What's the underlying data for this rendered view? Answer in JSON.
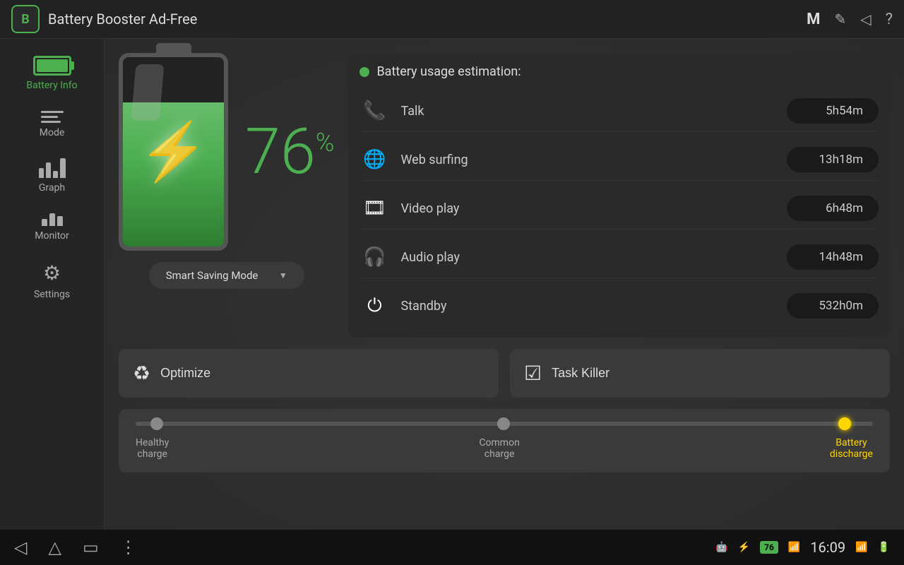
{
  "app": {
    "title": "Battery Booster Ad-Free",
    "icon_label": "B"
  },
  "top_icons": [
    "M",
    "✎",
    "◁",
    "?"
  ],
  "sidebar": {
    "items": [
      {
        "id": "battery-info",
        "label": "Battery Info",
        "active": true
      },
      {
        "id": "mode",
        "label": "Mode",
        "active": false
      },
      {
        "id": "graph",
        "label": "Graph",
        "active": false
      },
      {
        "id": "monitor",
        "label": "Monitor",
        "active": false
      },
      {
        "id": "settings",
        "label": "Settings",
        "active": false
      }
    ]
  },
  "battery": {
    "percent": "76",
    "percent_sign": "%"
  },
  "mode_dropdown": {
    "label": "Smart Saving Mode"
  },
  "usage": {
    "title": "Battery usage estimation:",
    "items": [
      {
        "id": "talk",
        "label": "Talk",
        "time": "5h54m",
        "icon": "📞"
      },
      {
        "id": "web-surfing",
        "label": "Web surfing",
        "time": "13h18m",
        "icon": "🌐"
      },
      {
        "id": "video-play",
        "label": "Video play",
        "time": "6h48m",
        "icon": "🎞"
      },
      {
        "id": "audio-play",
        "label": "Audio play",
        "time": "14h48m",
        "icon": "🎧"
      },
      {
        "id": "standby",
        "label": "Standby",
        "time": "532h0m",
        "icon": "⏻"
      }
    ]
  },
  "buttons": {
    "optimize": "Optimize",
    "task_killer": "Task Killer"
  },
  "charge_slider": {
    "labels": [
      {
        "id": "healthy",
        "text": "Healthy\ncharge",
        "active": false
      },
      {
        "id": "common",
        "text": "Common\ncharge",
        "active": false
      },
      {
        "id": "discharge",
        "text": "Battery\ndischarge",
        "active": true
      }
    ]
  },
  "bottom_bar": {
    "time": "16:09",
    "battery_level": "76"
  }
}
